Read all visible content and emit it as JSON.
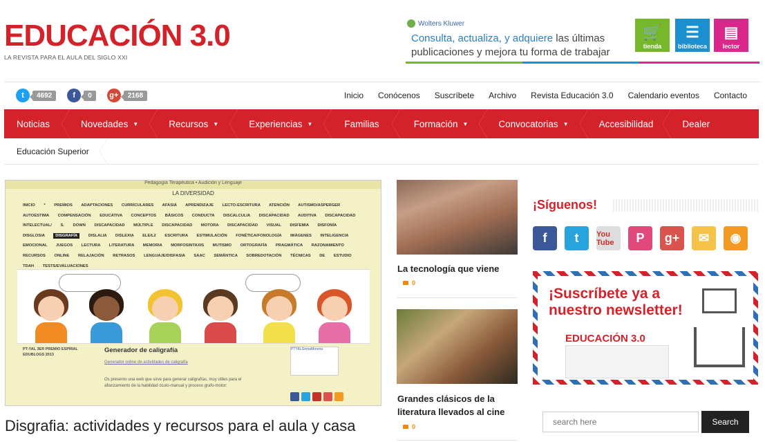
{
  "header": {
    "logo_title": "EDUCACIÓN 3.0",
    "logo_subtitle": "LA REVISTA PARA EL AULA DEL SIGLO XXI"
  },
  "banner": {
    "brand": "Wolters Kluwer",
    "line1_a": "Consulta, actualiza, y adquiere",
    "line1_b": " las últimas",
    "line2": "publicaciones y mejora tu forma de trabajar",
    "buttons": [
      "tienda",
      "biblioteca",
      "lector"
    ]
  },
  "social_counts": {
    "twitter": "4692",
    "facebook": "0",
    "googleplus": "2168"
  },
  "top_nav": [
    "Inicio",
    "Conócenos",
    "Suscríbete",
    "Archivo",
    "Revista Educación 3.0",
    "Calendario eventos",
    "Contacto"
  ],
  "main_nav": [
    {
      "label": "Noticias",
      "caret": ""
    },
    {
      "label": "Novedades",
      "caret": "▼"
    },
    {
      "label": "Recursos",
      "caret": "▼"
    },
    {
      "label": "Experiencias",
      "caret": "▼"
    },
    {
      "label": "Familias",
      "caret": ""
    },
    {
      "label": "Formación",
      "caret": "▼"
    },
    {
      "label": "Convocatorias",
      "caret": "▼"
    },
    {
      "label": "Accesibilidad",
      "caret": ""
    },
    {
      "label": "Dealer",
      "caret": ""
    }
  ],
  "sub_nav": [
    "Educación Superior"
  ],
  "feature": {
    "top_strip": "Pedagogía Terapéutica • Audición y Lenguaje",
    "diversity": "LA DIVERSIDAD",
    "tags_before": "INICIO * PREMIOS ADAPTACIONES CURRICULARES AFASIA APRENDIZAJE LECTO-ESCRITURA ATENCIÓN AUTISMO/ASPERGER AUTOESTIMA COMPENSACIÓN EDUCATIVA CONCEPTOS BÁSICOS CONDUCTA DISCALCULIA DISCAPACIDAD AUDITIVA DISCAPACIDAD INTELECTUAL/ S. DOWN DISCAPACIDAD MÚLTIPLE DISCAPACIDAD MOTORA DISCAPACIDAD VISUAL DISFEMIA DISFONÍA DISGLOSIA",
    "tag_highlight": "DISGRAFÍA",
    "tags_after": "DISLALIA DISLEXIA ELE/L2 ESCRITURA ESTIMULACIÓN FONÉTICA/FONOLOGÍA IMÁGENES INTELIGENCIA EMOCIONAL JUEGOS LECTURA LITERATURA MEMORIA MORFOSINTAXIS MUTISMO ORTOGRAFÍA PRAGMÁTICA RAZONAMIENTO RECURSOS ONLINE RELAJACIÓN RETRASOS LENGUAJE/DISFASIA SAAC SEMÁNTICA SOBREDOTACIÓN TÉCNICAS DE ESTUDIO TDAH TESTS/EVALUACIONES",
    "award": "PT-YAL 3ER PREMIO ESPIRAL EDUBLOGS 2013",
    "section_title": "Generador de caligrafía",
    "section_link": "Generador online de actividades de caligrafía",
    "section_text": "Os presento una web que sirve para generar caligrafías, muy útiles para el afianzamiento de la habilidad óculo-manual y proceso grafo-motor:",
    "card_name": "PTYALGemaMorena",
    "headline": "Disgrafia: actividades y recursos para el aula y casa"
  },
  "middle": [
    {
      "title": "La tecnología que viene",
      "comments": "0"
    },
    {
      "title": "Grandes clásicos de la literatura llevados al cine",
      "comments": "0"
    }
  ],
  "sidebar": {
    "follow_title": "¡Síguenos!",
    "social_icons": [
      "facebook-icon",
      "twitter-icon",
      "youtube-icon",
      "pinterest-icon",
      "googleplus-icon",
      "mail-icon",
      "rss-icon"
    ],
    "youtube_label": "You Tube",
    "newsletter_title": "¡Suscríbete ya a nuestro newsletter!",
    "newsletter_logo": "EDUCACIÓN 3.0",
    "search_placeholder": "search here",
    "search_button": "Search"
  },
  "colors": {
    "brand_red": "#d3222a",
    "comment_orange": "#f08a00"
  }
}
